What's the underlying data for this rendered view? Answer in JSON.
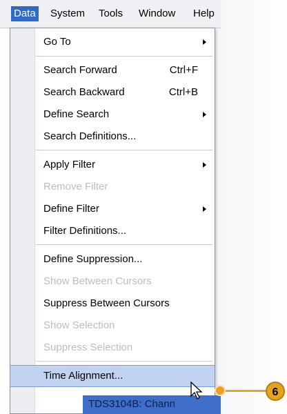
{
  "menubar": {
    "items": [
      {
        "label": "Data",
        "active": true
      },
      {
        "label": "System",
        "active": false
      },
      {
        "label": "Tools",
        "active": false
      },
      {
        "label": "Window",
        "active": false
      },
      {
        "label": "Help",
        "active": false
      }
    ]
  },
  "dropdown": {
    "items": [
      {
        "label": "Go To",
        "submenu": true,
        "disabled": false
      },
      {
        "label": "Search Forward",
        "shortcut": "Ctrl+F",
        "disabled": false
      },
      {
        "label": "Search Backward",
        "shortcut": "Ctrl+B",
        "disabled": false
      },
      {
        "label": "Define Search",
        "submenu": true,
        "disabled": false
      },
      {
        "label": "Search Definitions...",
        "disabled": false
      },
      {
        "label": "Apply Filter",
        "submenu": true,
        "disabled": false
      },
      {
        "label": "Remove Filter",
        "disabled": true
      },
      {
        "label": "Define Filter",
        "submenu": true,
        "disabled": false
      },
      {
        "label": "Filter Definitions...",
        "disabled": false
      },
      {
        "label": "Define Suppression...",
        "disabled": false
      },
      {
        "label": "Show Between Cursors",
        "disabled": true
      },
      {
        "label": "Suppress Between Cursors",
        "disabled": false
      },
      {
        "label": "Show Selection",
        "disabled": true
      },
      {
        "label": "Suppress Selection",
        "disabled": true
      },
      {
        "label": "Time Alignment...",
        "disabled": false,
        "highlighted": true
      }
    ]
  },
  "window_text": "TDS3104B: Chann",
  "callout": {
    "number": "6",
    "color": "#e4a41f"
  },
  "colors": {
    "menu_highlight": "#316ac5",
    "item_highlight": "#c1d3f0"
  }
}
